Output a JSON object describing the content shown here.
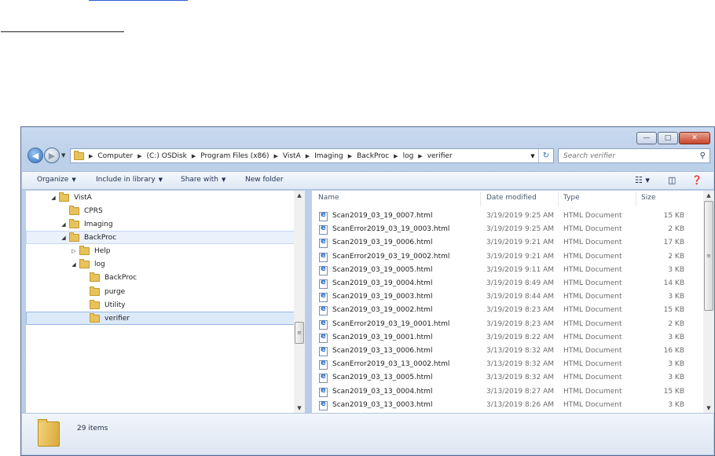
{
  "window": {
    "caption_buttons": {
      "minimize": "—",
      "maximize": "□",
      "close": "✕"
    }
  },
  "address": {
    "breadcrumbs": [
      "Computer",
      "(C:) OSDisk",
      "Program Files (x86)",
      "VistA",
      "Imaging",
      "BackProc",
      "log",
      "verifier"
    ],
    "search_placeholder": "Search verifier"
  },
  "toolbar": {
    "organize": "Organize",
    "include_in_library": "Include in library",
    "share_with": "Share with",
    "new_folder": "New folder"
  },
  "tree": {
    "items": [
      {
        "label": "VistA",
        "expander": "◢"
      },
      {
        "label": "CPRS",
        "expander": ""
      },
      {
        "label": "Imaging",
        "expander": "◢"
      },
      {
        "label": "BackProc",
        "expander": "◢"
      },
      {
        "label": "Help",
        "expander": "▷"
      },
      {
        "label": "log",
        "expander": "◢"
      },
      {
        "label": "BackProc",
        "expander": ""
      },
      {
        "label": "purge",
        "expander": ""
      },
      {
        "label": "Utility",
        "expander": ""
      },
      {
        "label": "verifier",
        "expander": ""
      }
    ],
    "selected": "verifier"
  },
  "files": {
    "columns": {
      "name": "Name",
      "date": "Date modified",
      "type": "Type",
      "size": "Size"
    },
    "rows": [
      {
        "name": "Scan2019_03_19_0007.html",
        "date": "3/19/2019 9:25 AM",
        "type": "HTML Document",
        "size": "15 KB"
      },
      {
        "name": "ScanError2019_03_19_0003.html",
        "date": "3/19/2019 9:25 AM",
        "type": "HTML Document",
        "size": "2 KB"
      },
      {
        "name": "Scan2019_03_19_0006.html",
        "date": "3/19/2019 9:21 AM",
        "type": "HTML Document",
        "size": "17 KB"
      },
      {
        "name": "ScanError2019_03_19_0002.html",
        "date": "3/19/2019 9:21 AM",
        "type": "HTML Document",
        "size": "2 KB"
      },
      {
        "name": "Scan2019_03_19_0005.html",
        "date": "3/19/2019 9:11 AM",
        "type": "HTML Document",
        "size": "3 KB"
      },
      {
        "name": "Scan2019_03_19_0004.html",
        "date": "3/19/2019 8:49 AM",
        "type": "HTML Document",
        "size": "14 KB"
      },
      {
        "name": "Scan2019_03_19_0003.html",
        "date": "3/19/2019 8:44 AM",
        "type": "HTML Document",
        "size": "3 KB"
      },
      {
        "name": "Scan2019_03_19_0002.html",
        "date": "3/19/2019 8:23 AM",
        "type": "HTML Document",
        "size": "15 KB"
      },
      {
        "name": "ScanError2019_03_19_0001.html",
        "date": "3/19/2019 8:23 AM",
        "type": "HTML Document",
        "size": "2 KB"
      },
      {
        "name": "Scan2019_03_19_0001.html",
        "date": "3/19/2019 8:22 AM",
        "type": "HTML Document",
        "size": "3 KB"
      },
      {
        "name": "Scan2019_03_13_0006.html",
        "date": "3/13/2019 8:32 AM",
        "type": "HTML Document",
        "size": "16 KB"
      },
      {
        "name": "ScanError2019_03_13_0002.html",
        "date": "3/13/2019 8:32 AM",
        "type": "HTML Document",
        "size": "3 KB"
      },
      {
        "name": "Scan2019_03_13_0005.html",
        "date": "3/13/2019 8:32 AM",
        "type": "HTML Document",
        "size": "3 KB"
      },
      {
        "name": "Scan2019_03_13_0004.html",
        "date": "3/13/2019 8:27 AM",
        "type": "HTML Document",
        "size": "15 KB"
      },
      {
        "name": "Scan2019_03_13_0003.html",
        "date": "3/13/2019 8:26 AM",
        "type": "HTML Document",
        "size": "3 KB"
      }
    ]
  },
  "status": {
    "item_count": "29 items"
  },
  "colors": {
    "window_frame": "#bcd0ea",
    "selection": "#dce9f9",
    "link": "#2b5bd7"
  }
}
